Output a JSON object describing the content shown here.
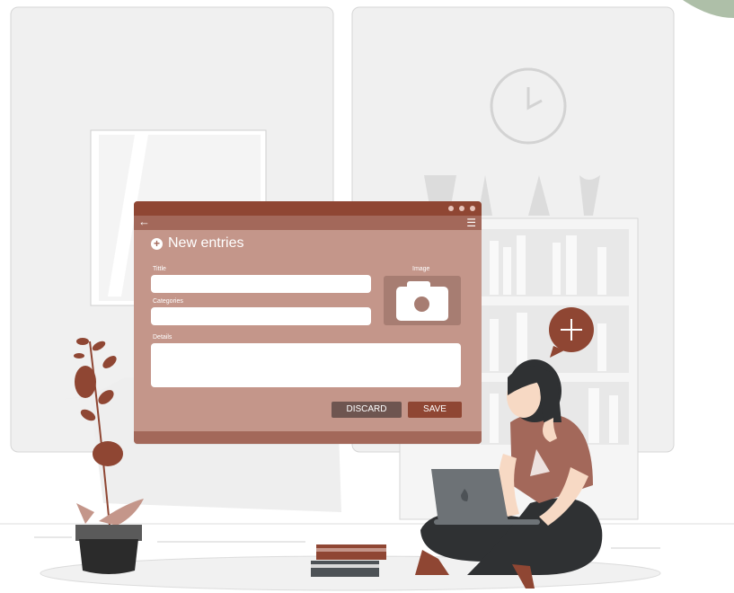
{
  "colors": {
    "window_topbar": "#8f4633",
    "window_navbar": "#a3685a",
    "window_body": "#c4968a",
    "accent_red": "#8f4633",
    "hair": "#3a3a3a",
    "shirt": "#a3685a"
  },
  "window": {
    "back_icon": "arrow-left-icon",
    "menu_icon": "hamburger-icon",
    "title": "New entries",
    "fields": {
      "title_label": "Tittle",
      "categories_label": "Categories",
      "details_label": "Details",
      "image_label": "Image"
    },
    "buttons": {
      "discard": "DISCARD",
      "save": "SAVE"
    }
  }
}
